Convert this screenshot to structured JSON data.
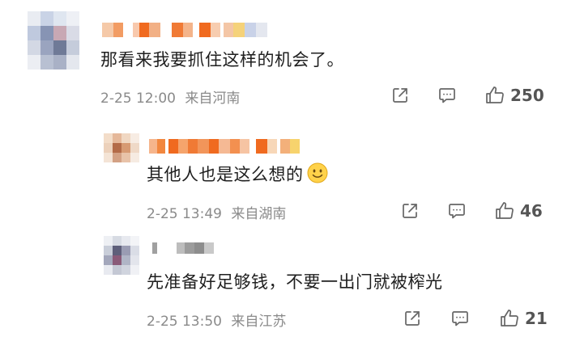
{
  "comments": [
    {
      "text": "那看来我要抓住这样的机会了。",
      "date": "2-25 12:00",
      "location": "来自河南",
      "likes": "250",
      "icons": [
        "share-icon",
        "reply-icon",
        "like-icon"
      ]
    },
    {
      "text": "其他人也是这么想的",
      "emoji": "smile-emoji",
      "date": "2-25 13:49",
      "location": "来自湖南",
      "likes": "46",
      "icons": [
        "share-icon",
        "reply-icon",
        "like-icon"
      ]
    },
    {
      "text": "先准备好足够钱，不要一出门就被榨光",
      "date": "2-25 13:50",
      "location": "来自江苏",
      "likes": "21",
      "icons": [
        "share-icon",
        "reply-icon",
        "like-icon"
      ]
    }
  ]
}
